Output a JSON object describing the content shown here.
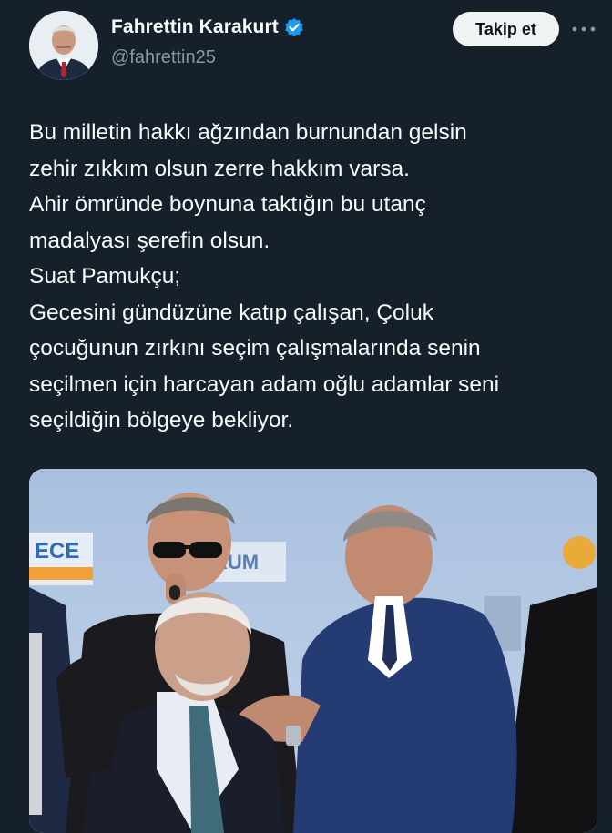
{
  "author": {
    "display_name": "Fahrettin Karakurt",
    "handle": "@fahrettin25",
    "verified": true,
    "avatar_icon": "profile-photo"
  },
  "actions": {
    "follow_label": "Takip et",
    "more_icon": "more-horizontal-icon"
  },
  "tweet": {
    "lines": [
      "Bu milletin hakkı ağzından burnundan gelsin",
      "zehir zıkkım olsun zerre hakkım varsa.",
      "Ahir ömründe boynuna taktığın bu utanç",
      "madalyası şerefin olsun.",
      "Suat Pamukçu;",
      "Gecesini gündüzüne katıp çalışan, Çoluk",
      "çocuğunun zırkını seçim çalışmalarında senin",
      "seçilmen için harcayan adam oğlu adamlar seni",
      "seçildiğin bölgeye bekliyor."
    ]
  },
  "media": {
    "background_text_left": "ECE",
    "background_text_mid": "RUM"
  },
  "colors": {
    "background": "#15202b",
    "verified": "#1d9bf0",
    "secondary_text": "#8b98a5",
    "button_bg": "#eff3f4"
  }
}
